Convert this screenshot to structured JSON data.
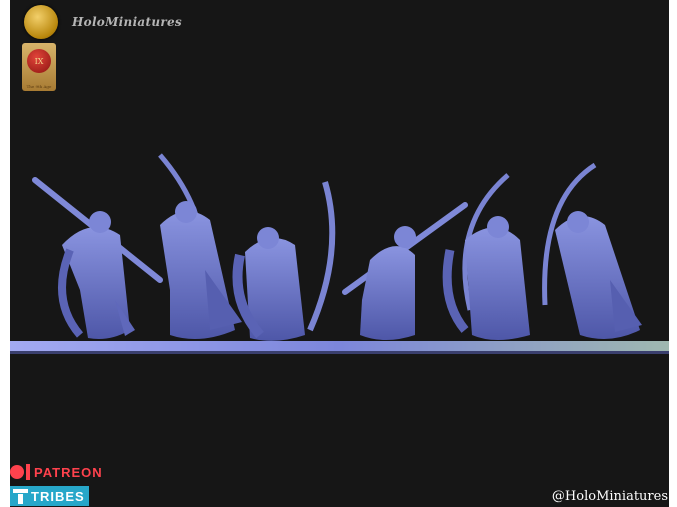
{
  "brand": {
    "name": "HoloMiniatures",
    "badge_icon": "golden-coin-logo-icon",
    "seal_text": "IX",
    "seal_caption": "The 9th Age"
  },
  "badges": {
    "patreon_label": "PATREON",
    "tribes_label": "TRIBES",
    "patreon_color": "#ff424d",
    "tribes_color": "#27a7c9"
  },
  "credit": "@HoloMiniatures",
  "colors": {
    "background": "#161616",
    "miniature": "#6f79c9",
    "base_strip": "#8e9be6"
  }
}
